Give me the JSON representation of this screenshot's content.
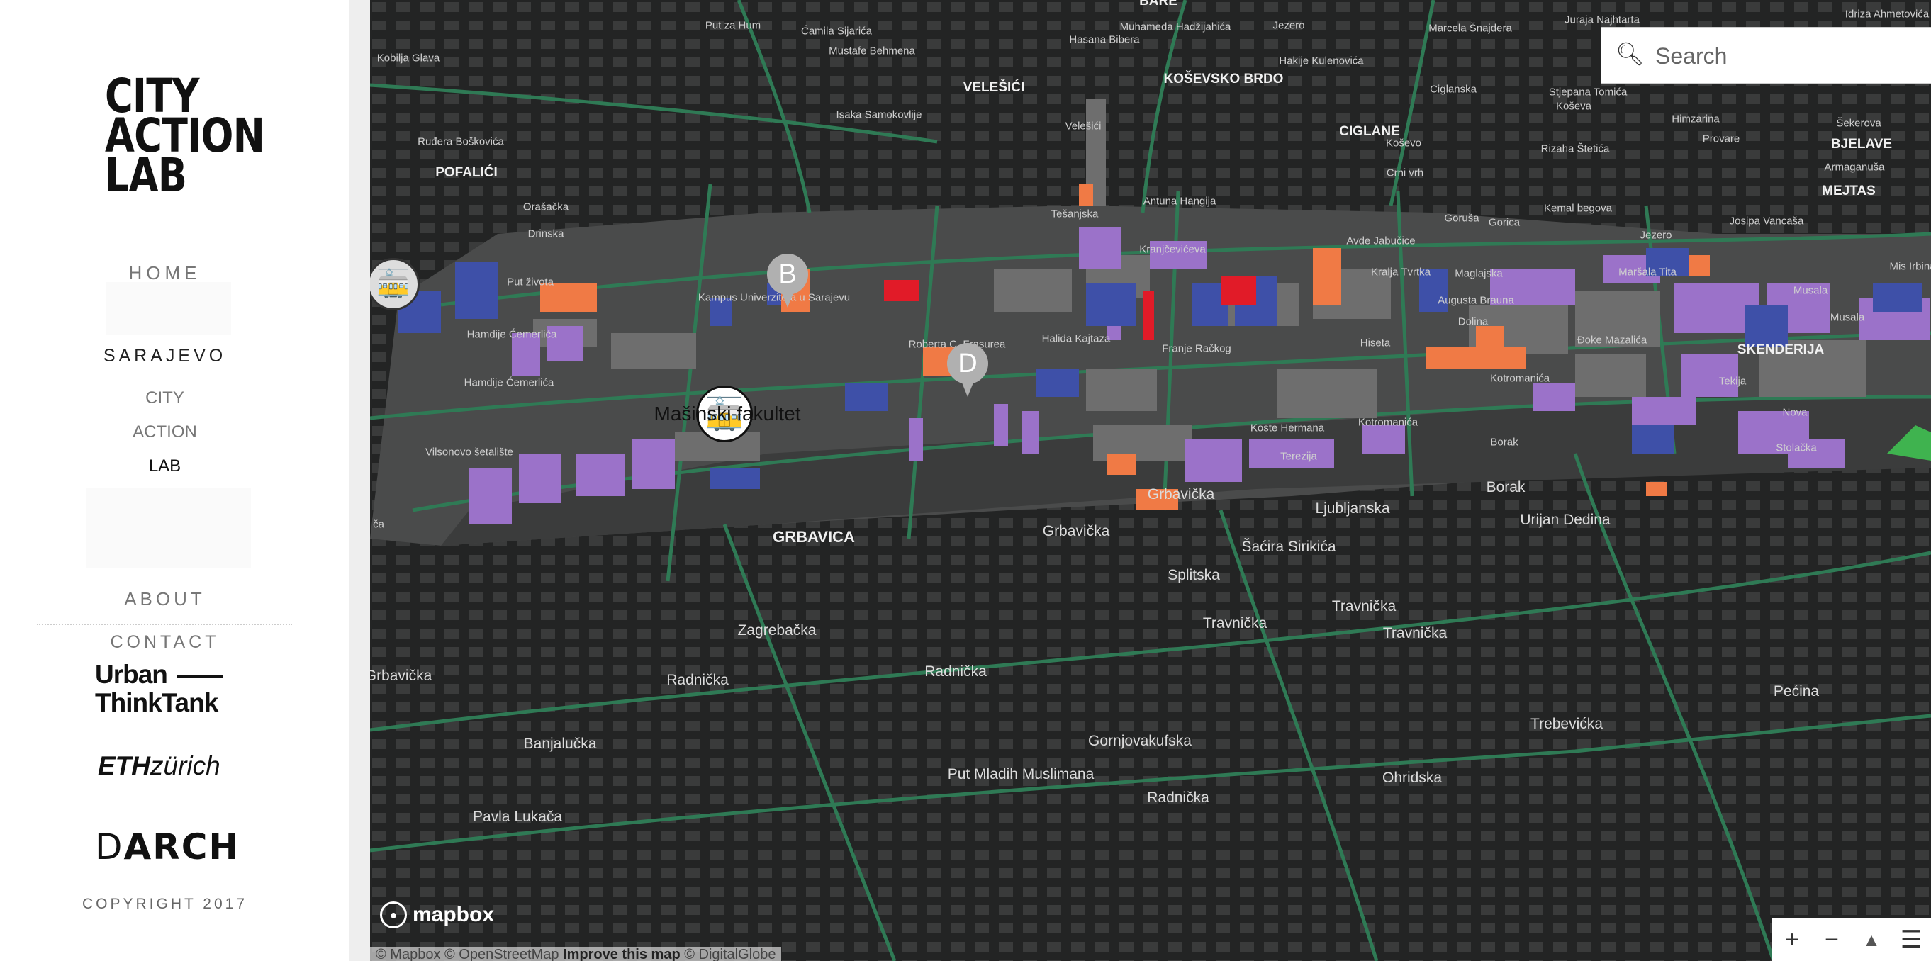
{
  "sidebar": {
    "logo_lines": [
      "CITY",
      "ACTION",
      "LAB"
    ],
    "nav": {
      "home": "HOME",
      "city_heading": "SARAJEVO",
      "sub": [
        "CITY",
        "ACTION",
        "LAB"
      ],
      "about": "ABOUT",
      "contact": "CONTACT"
    },
    "partners": {
      "urban_line1": "Urban",
      "urban_line2": "ThinkTank",
      "eth_bold": "ETH",
      "eth_italic": "zürich",
      "darch_d": "D",
      "darch_rest": "ARCH"
    },
    "copyright": "COPYRIGHT 2017"
  },
  "map": {
    "search": {
      "placeholder": "Search"
    },
    "markers": {
      "pin_b": "B",
      "pin_d": "D",
      "tram_label": "Mašinski fakultet"
    },
    "labels": {
      "velesici": "VELEŠIĆI",
      "kosevsko_brdo": "KOŠEVSKO BRDO",
      "ciglane": "CIGLANE",
      "pofalici": "POFALIĆI",
      "bjelave": "BJELAVE",
      "mejtas": "MEJTAS",
      "skenderija": "SKENDERIJA",
      "grbavica": "GRBAVICA",
      "put_za_hum": "Put za Hum",
      "camila_sijarica": "Ćamila Sijarića",
      "mustafe_behmena": "Mustafe Behmena",
      "muhameda_hadzijahica": "Muhameda Hadžijahića",
      "hasana_bibera": "Hasana Bibera",
      "jezero_top": "Jezero",
      "marcela_snajdera": "Marcela Šnajdera",
      "juraja_najhtarta": "Juraja Najhtarta",
      "idriza_ahmetovica": "Idriza Ahmetovića",
      "kobilja_glava": "Kobilja Glava",
      "isaka_samokovlije": "Isaka Samokovlije",
      "hakije_kulenovica": "Hakije Kulenovića",
      "ciglanska": "Ciglanska",
      "stjepana_tomica": "Stjepana Tomića",
      "koseva": "Koševa",
      "himzarina": "Himzarina",
      "sekerova": "Šekerova",
      "rudera_boskovica": "Ruđera Boškovića",
      "veleici": "Velešići",
      "kosevo": "Koševo",
      "rizaha_stetica": "Rizaha Štetića",
      "provare": "Provare",
      "armaganusa": "Armaganuša",
      "crni_vrh": "Crni vrh",
      "antuna_hangija": "Antuna Hangija",
      "orasacka": "Orašačka",
      "tesanjska": "Tešanjska",
      "kemal_begova": "Kemal begova",
      "gorica": "Gorica",
      "goruša": "Goruša",
      "drinska": "Drinska",
      "avde_jabucice": "Avde Jabučice",
      "jezero_mid": "Jezero",
      "josipa_vancasa": "Josipa Vancaša",
      "krancceviceva": "Kranjčevićeva",
      "kralja_tvrtka": "Kralja Tvrtka",
      "maglajska": "Maglajska",
      "marsala_tita": "Maršala Tita",
      "put_zivota": "Put života",
      "kampus": "Kampus Univerziteta u Sarajevu",
      "augusta_brauna": "Augusta Brauna",
      "musala_1": "Musala",
      "mis_irbina": "Mis Irbina",
      "hamdije_cemerlica_1": "Hamdije Ćemerlića",
      "dolina": "Dolina",
      "musala_2": "Musala",
      "roberta_cirurea": "Roberta C. Frasurea",
      "halida_kajtaza": "Halida Kajtaza",
      "hiseta": "Hiseta",
      "doke_mazalica": "Đoke Mazalića",
      "franje_rackog": "Franje Račkog",
      "hamdije_cemerlica_2": "Hamdije Ćemerlića",
      "kotromanica_1": "Kotromanića",
      "tekija": "Tekija",
      "kotromanica_2": "Kotromanića",
      "koste_hermana": "Koste Hermana",
      "nova": "Nova",
      "borak_1": "Borak",
      "vilsonovo": "Vilsonovo šetalište",
      "terezija": "Terezija",
      "stolacka": "Stolačka",
      "borak_2": "Borak",
      "grbavicka_1": "Grbavička",
      "ljubljanska": "Ljubljanska",
      "urijan_dedina": "Urijan Dedina",
      "grbavicka_2": "Grbavička",
      "sacira_sirikica": "Šaćira Sirikića",
      "splitska": "Splitska",
      "travnicka_1": "Travnička",
      "travnicka_2": "Travnička",
      "travnicka_3": "Travnička",
      "zagrebacka": "Zagrebačka",
      "radnicka_1": "Radnička",
      "radnicka_2": "Radnička",
      "grbavicka_3": "Grbavička",
      "pecina": "Pećina",
      "trebevicka": "Trebevićka",
      "banjalucka": "Banjalučka",
      "gornjovakufska": "Gornjovakufska",
      "put_mladih": "Put Mladih Muslimana",
      "ohridska": "Ohridska",
      "radnicka_3": "Radnička",
      "pavla_lukaca": "Pavla Lukača",
      "bare": "BARE",
      "edge_a": "ča"
    },
    "branding": {
      "mapbox": "mapbox",
      "attribution_prefix": "© Mapbox © OpenStreetMap",
      "attribution_link": "Improve this map",
      "attribution_suffix": "© DigitalGlobe"
    },
    "controls": {
      "zoom_in": "+",
      "zoom_out": "−",
      "compass": "▲",
      "menu": "☰"
    },
    "colors": {
      "background": "#1f2020",
      "road": "#2f7a55",
      "building_gray": "#6e6e6e",
      "building_purple": "#9b72c9",
      "building_blue": "#3e50a8",
      "building_orange": "#f07a45",
      "building_red": "#e11b28",
      "building_green": "#3fb34f"
    }
  }
}
